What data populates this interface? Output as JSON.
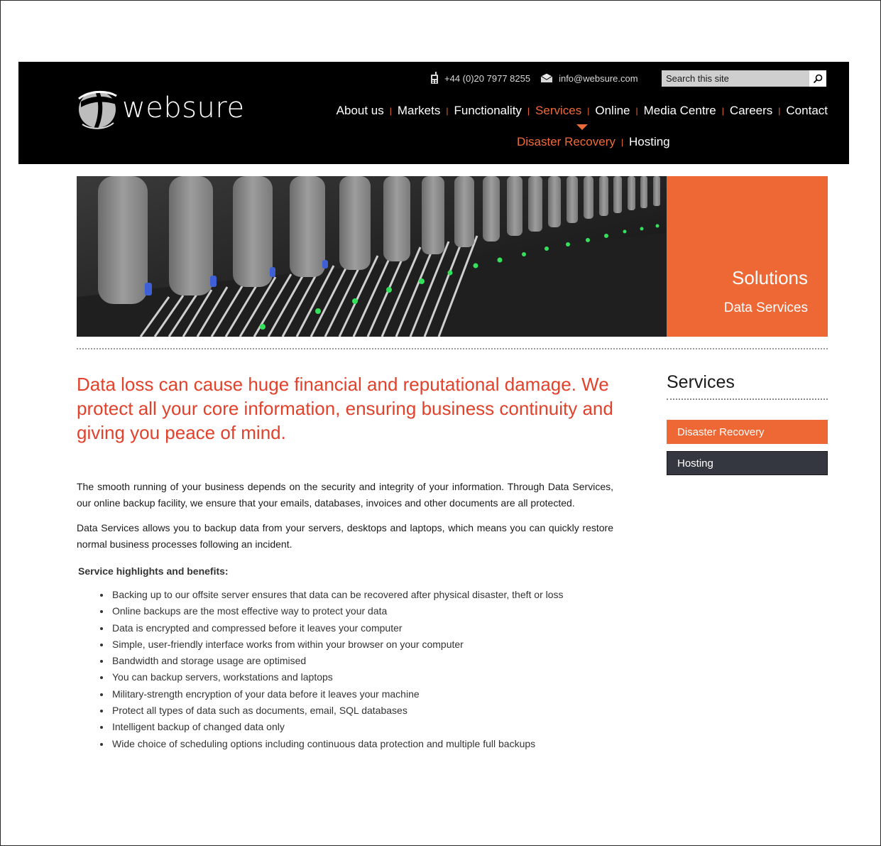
{
  "brand": {
    "name": "websure"
  },
  "contact": {
    "phone": "+44 (0)20 7977 8255",
    "email": "info@websure.com"
  },
  "search": {
    "placeholder": "Search this site"
  },
  "nav": {
    "items": [
      {
        "label": "About us",
        "active": false
      },
      {
        "label": "Markets",
        "active": false
      },
      {
        "label": "Functionality",
        "active": false
      },
      {
        "label": "Services",
        "active": true
      },
      {
        "label": "Online",
        "active": false
      },
      {
        "label": "Media Centre",
        "active": false
      },
      {
        "label": "Careers",
        "active": false
      },
      {
        "label": "Contact",
        "active": false
      }
    ],
    "sub_items": [
      {
        "label": "Disaster Recovery",
        "active": true
      },
      {
        "label": "Hosting",
        "active": false
      }
    ]
  },
  "banner": {
    "title": "Solutions",
    "subtitle": "Data Services"
  },
  "content": {
    "lead": "Data loss can cause huge financial and reputational damage. We protect all your core information, ensuring business continuity and giving you peace of mind.",
    "para1": "The smooth running of your business depends on the security and integrity of your information. Through Data Services, our online backup facility, we ensure that your emails, databases, invoices and other documents are all protected.",
    "para2": "Data Services allows you to backup data from your servers, desktops and laptops, which means you can quickly restore normal business processes following an incident.",
    "highlights_heading": "Service highlights and benefits:",
    "highlights": [
      "Backing up to our offsite server ensures that data can be recovered after physical disaster, theft or loss",
      "Online backups are the most effective way to protect your data",
      "Data is encrypted and compressed before it leaves your computer",
      "Simple, user-friendly interface works from within your browser on your computer",
      "Bandwidth and storage usage are optimised",
      "You can backup servers, workstations and laptops",
      "Military-strength encryption of your data before it leaves your machine",
      "Protect all types of data such as documents, email, SQL databases",
      "Intelligent backup of changed data only",
      "Wide choice of scheduling options including continuous data protection and multiple full backups"
    ]
  },
  "sidebar": {
    "title": "Services",
    "links": [
      {
        "label": "Disaster Recovery",
        "style": "orange"
      },
      {
        "label": "Hosting",
        "style": "dark"
      }
    ]
  },
  "colors": {
    "accent": "#ee6836",
    "lead_text": "#e2412b",
    "header_bg": "#000000",
    "sidebar_dark": "#34373f"
  }
}
